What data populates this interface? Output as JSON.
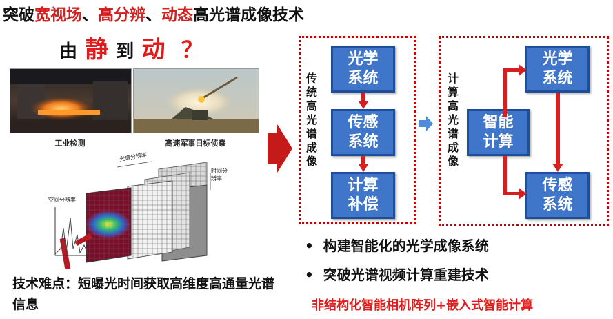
{
  "title": {
    "p1": "突破",
    "p2": "宽视场",
    "p3": "、",
    "p4": "高分辨",
    "p5": "、",
    "p6": "动态",
    "p7": "高光谱成像技术"
  },
  "static_to_dynamic": {
    "from": "由",
    "static": "静",
    "to": "到",
    "dynamic": "动",
    "question": "？"
  },
  "photos": {
    "industrial_caption": "工业检测",
    "military_caption": "高速军事目标侦察"
  },
  "cube_figure": {
    "spectral_resolution": "光谱分辨率",
    "spatial_resolution": "空间分辨率",
    "temporal_resolution": "时间分辨率"
  },
  "traditional": {
    "label": "传统高光谱成像",
    "blocks": [
      "光学系统",
      "传感系统",
      "计算补偿"
    ]
  },
  "computational": {
    "label": "计算高光谱成像",
    "blocks": {
      "smart": "智能计算",
      "optical": "光学系统",
      "sensor": "传感系统"
    }
  },
  "bullets": [
    "构建智能化的光学成像系统",
    "突破光谱视频计算重建技术"
  ],
  "bottom_red": "非结构化智能相机阵列+嵌入式智能计算",
  "difficulty": "技术难点：短曝光时间获取高维度高通量光谱信息",
  "colors": {
    "accent_red": "#e21b1b",
    "block_blue": "#3f76c9",
    "dashed_border": "#c00000"
  }
}
